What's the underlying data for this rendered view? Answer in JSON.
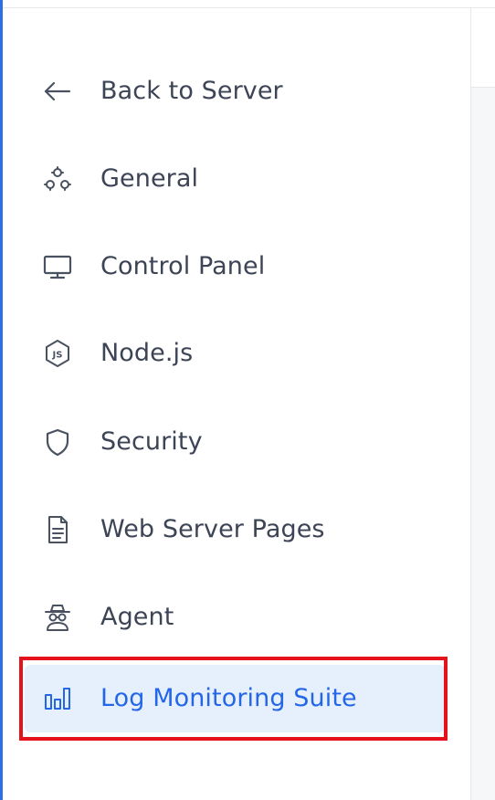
{
  "sidebar": {
    "items": [
      {
        "label": "Back to Server",
        "icon": "arrow-left-icon"
      },
      {
        "label": "General",
        "icon": "gears-icon"
      },
      {
        "label": "Control Panel",
        "icon": "monitor-icon"
      },
      {
        "label": "Node.js",
        "icon": "nodejs-icon"
      },
      {
        "label": "Security",
        "icon": "shield-icon"
      },
      {
        "label": "Web Server Pages",
        "icon": "document-icon"
      },
      {
        "label": "Agent",
        "icon": "agent-icon"
      },
      {
        "label": "Log Monitoring Suite",
        "icon": "bar-chart-icon",
        "active": true
      }
    ]
  },
  "colors": {
    "accent": "#2466e8",
    "active_background": "#e6effc",
    "text": "#3c4455",
    "highlight": "#e3121b"
  }
}
